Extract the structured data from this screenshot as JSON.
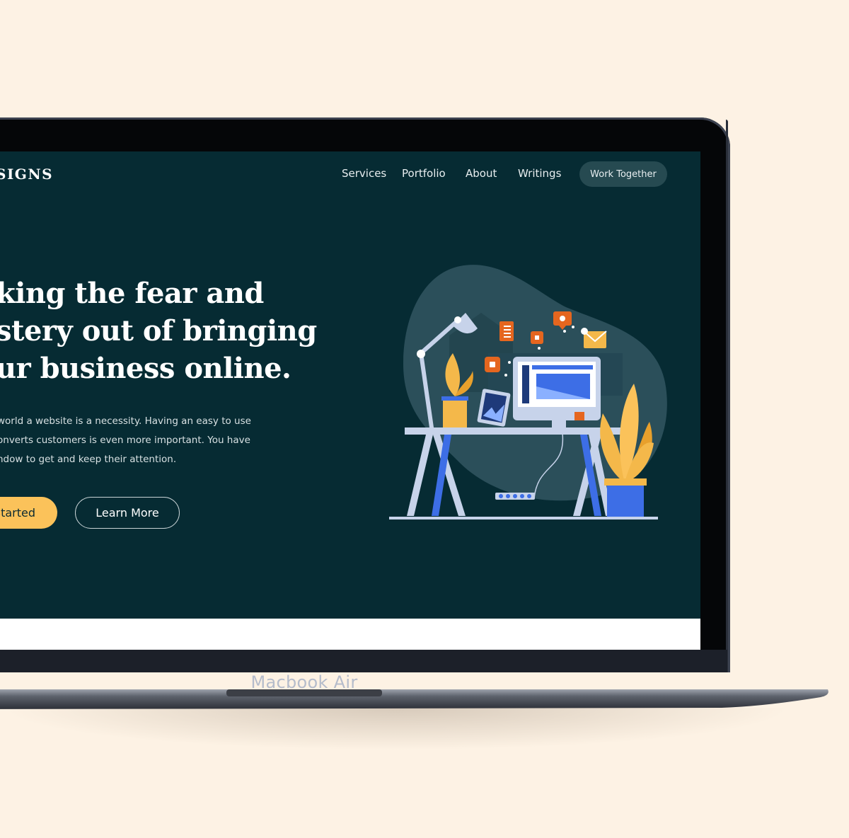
{
  "device": {
    "model_label": "Macbook Air"
  },
  "site": {
    "brand": "SIGNS",
    "nav": {
      "links": [
        "Services",
        "Portfolio",
        "About",
        "Writings"
      ],
      "cta": "Work Together"
    },
    "hero": {
      "title_lines": [
        "king the fear and",
        "stery out of bringing",
        "ur business online."
      ],
      "body_lines": [
        "world a website is a necessity. Having an easy to use",
        "onverts customers is even more important. You have",
        "ndow to get and keep their attention."
      ],
      "primary_button": "Started",
      "secondary_button": "Learn More"
    }
  },
  "colors": {
    "page_background": "#fdf2e4",
    "screen_background": "#062b33",
    "accent_yellow": "#fbc25a",
    "nav_pill": "#264a51",
    "illustration_blue": "#3d6ee6",
    "illustration_orange": "#e5661f"
  },
  "icons": [
    "desk-lamp-icon",
    "document-icon",
    "chat-bubble-icon",
    "notification-badge-icon",
    "mail-icon",
    "monitor-icon",
    "tablet-icon",
    "potted-plant-icon",
    "power-strip-icon"
  ]
}
